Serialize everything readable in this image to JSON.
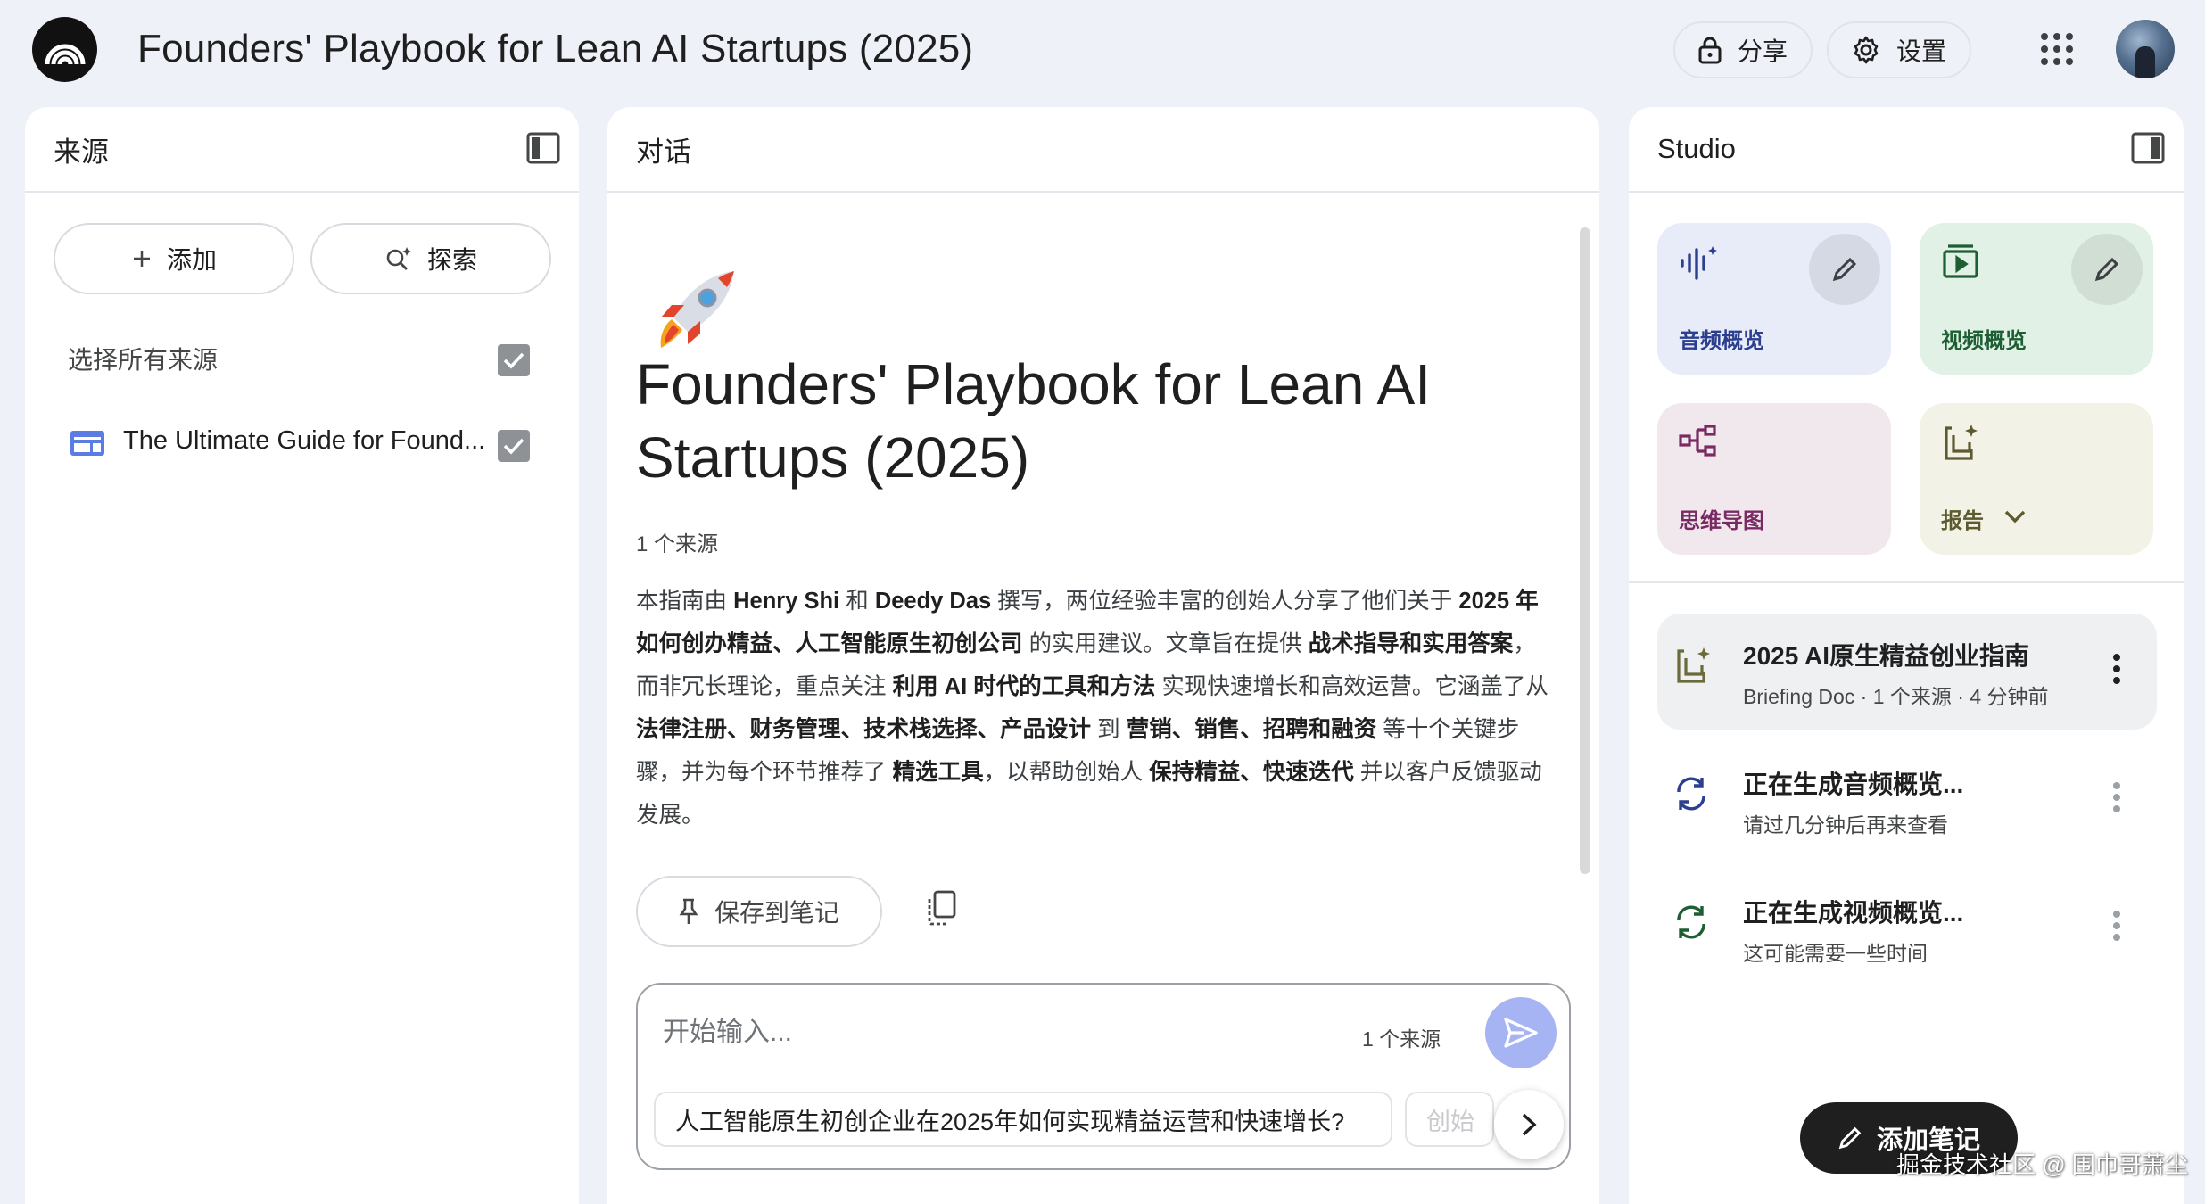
{
  "header": {
    "title": "Founders' Playbook for Lean AI Startups (2025)",
    "share_label": "分享",
    "settings_label": "设置"
  },
  "sources_panel": {
    "title": "来源",
    "add_label": "添加",
    "explore_label": "探索",
    "select_all_label": "选择所有来源",
    "items": [
      {
        "title": "The Ultimate Guide for Found...",
        "checked": true
      }
    ]
  },
  "chat_panel": {
    "title": "对话",
    "emoji": "🚀",
    "doc_title": "Founders' Playbook for Lean AI Startups (2025)",
    "source_count": "1 个来源",
    "summary": [
      {
        "t": "本指南由 "
      },
      {
        "t": "Henry Shi",
        "b": true
      },
      {
        "t": " 和 "
      },
      {
        "t": "Deedy Das",
        "b": true
      },
      {
        "t": " 撰写，两位经验丰富的创始人分享了他们关于 "
      },
      {
        "t": "2025 年如何创办精益、人工智能原生初创公司",
        "b": true
      },
      {
        "t": " 的实用建议。文章旨在提供 "
      },
      {
        "t": "战术指导和实用答案",
        "b": true
      },
      {
        "t": "，而非冗长理论，重点关注 "
      },
      {
        "t": "利用 AI 时代的工具和方法",
        "b": true
      },
      {
        "t": " 实现快速增长和高效运营。它涵盖了从 "
      },
      {
        "t": "法律注册、财务管理、技术栈选择、产品设计",
        "b": true
      },
      {
        "t": " 到 "
      },
      {
        "t": "营销、销售、招聘和融资",
        "b": true
      },
      {
        "t": " 等十个关键步骤，并为每个环节推荐了 "
      },
      {
        "t": "精选工具",
        "b": true
      },
      {
        "t": "，以帮助创始人 "
      },
      {
        "t": "保持精益、快速迭代",
        "b": true
      },
      {
        "t": " 并以客户反馈驱动发展。"
      }
    ],
    "save_note_label": "保存到笔记",
    "composer": {
      "placeholder": "开始输入...",
      "source_count": "1 个来源"
    },
    "suggestions": [
      "人工智能原生初创企业在2025年如何实现精益运营和快速增长?",
      "创始"
    ]
  },
  "studio_panel": {
    "title": "Studio",
    "tiles": [
      {
        "label": "音频概览",
        "bg": "#e8ecf8",
        "fg": "#2c3f8f"
      },
      {
        "label": "视频概览",
        "bg": "#e2f1e6",
        "fg": "#1d5e33"
      },
      {
        "label": "思维导图",
        "bg": "#f1e8ee",
        "fg": "#7a2a63"
      },
      {
        "label": "报告",
        "bg": "#f3f2e6",
        "fg": "#5e5a2f"
      }
    ],
    "notes": [
      {
        "title": "2025 AI原生精益创业指南",
        "subtitle": "Briefing Doc · 1 个来源 · 4 分钟前"
      },
      {
        "title": "正在生成音频概览...",
        "subtitle": "请过几分钟后再来查看"
      },
      {
        "title": "正在生成视频概览...",
        "subtitle": "这可能需要一些时间"
      }
    ],
    "add_note_label": "添加笔记"
  },
  "watermark": "掘金技术社区 @ 围巾哥萧尘"
}
